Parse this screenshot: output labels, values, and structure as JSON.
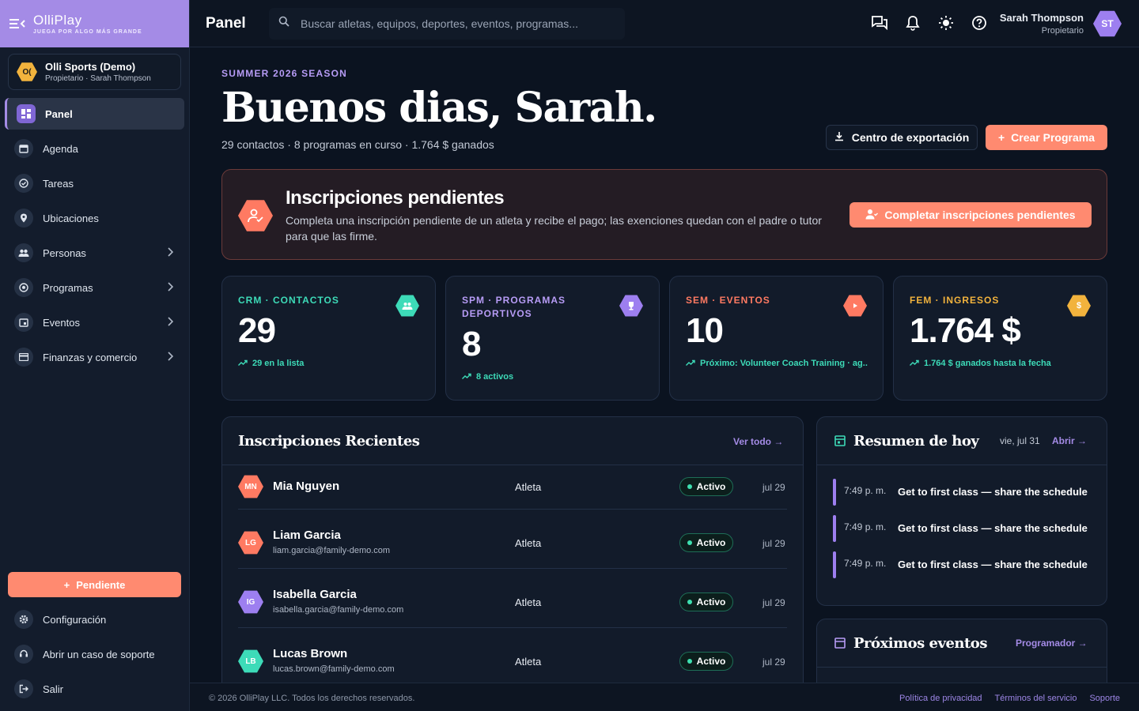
{
  "brand": {
    "name": "OlliPlay",
    "tagline": "JUEGA POR ALGO MÁS GRANDE",
    "color": "#a48be6"
  },
  "org": {
    "name": "Olli Sports (Demo)",
    "sub": "Propietario · Sarah Thompson",
    "badge": "O("
  },
  "sidebar": {
    "items": [
      {
        "label": "Panel",
        "icon": "dashboard-icon",
        "active": true
      },
      {
        "label": "Agenda",
        "icon": "calendar-icon"
      },
      {
        "label": "Tareas",
        "icon": "check-circle-icon"
      },
      {
        "label": "Ubicaciones",
        "icon": "location-pin-icon"
      },
      {
        "label": "Personas",
        "icon": "people-icon",
        "expandable": true
      },
      {
        "label": "Programas",
        "icon": "soccer-ball-icon",
        "expandable": true
      },
      {
        "label": "Eventos",
        "icon": "event-icon",
        "expandable": true
      },
      {
        "label": "Finanzas y comercio",
        "icon": "credit-card-icon",
        "expandable": true
      }
    ],
    "pending_label": "Pendiente",
    "bottom": [
      {
        "label": "Configuración",
        "icon": "gear-icon"
      },
      {
        "label": "Abrir un caso de soporte",
        "icon": "support-agent-icon"
      },
      {
        "label": "Salir",
        "icon": "logout-icon"
      }
    ]
  },
  "topbar": {
    "title": "Panel",
    "search_placeholder": "Buscar atletas, equipos, deportes, eventos, programas...",
    "user_name": "Sarah Thompson",
    "user_role": "Propietario",
    "user_initials": "ST"
  },
  "hero": {
    "season": "SUMMER 2026 SEASON",
    "greeting": "Buenos dias, Sarah.",
    "subtitle": "29 contactos · 8 programas en curso · 1.764 $ ganados",
    "export_label": "Centro de exportación",
    "create_label": "Crear Programa"
  },
  "alert": {
    "title": "Inscripciones pendientes",
    "text": "Completa una inscripción pendiente de un atleta y recibe el pago; las exenciones quedan con el padre o tutor para que las firme.",
    "button": "Completar inscripciones pendientes"
  },
  "stats": [
    {
      "label": "CRM · CONTACTOS",
      "value": "29",
      "note": "29 en la lista",
      "color": "#3ddbb8",
      "icon": "group-icon"
    },
    {
      "label": "SPM · PROGRAMAS DEPORTIVOS",
      "value": "8",
      "note": "8 activos",
      "color": "#b79cf6",
      "icon": "trophy-icon"
    },
    {
      "label": "SEM · EVENTOS",
      "value": "10",
      "note": "Próximo: Volunteer Coach Training · ag...",
      "color": "#ff7a62",
      "icon": "play-icon"
    },
    {
      "label": "FEM · INGRESOS",
      "value": "1.764 $",
      "note": "1.764 $ ganados hasta la fecha",
      "color": "#f2b33d",
      "icon": "dollar-icon"
    }
  ],
  "recent": {
    "title": "Inscripciones Recientes",
    "link": "Ver todo →",
    "rows": [
      {
        "initials": "MN",
        "name": "Mia Nguyen",
        "email": "",
        "role": "Atleta",
        "status": "Activo",
        "date": "jul 29",
        "color": "#ff7a62"
      },
      {
        "initials": "LG",
        "name": "Liam Garcia",
        "email": "liam.garcia@family-demo.com",
        "role": "Atleta",
        "status": "Activo",
        "date": "jul 29",
        "color": "#ff7a62"
      },
      {
        "initials": "IG",
        "name": "Isabella Garcia",
        "email": "isabella.garcia@family-demo.com",
        "role": "Atleta",
        "status": "Activo",
        "date": "jul 29",
        "color": "#9d7ff0"
      },
      {
        "initials": "LB",
        "name": "Lucas Brown",
        "email": "lucas.brown@family-demo.com",
        "role": "Atleta",
        "status": "Activo",
        "date": "jul 29",
        "color": "#3ddbb8"
      }
    ]
  },
  "today": {
    "title": "Resumen de hoy",
    "date": "vie, jul 31",
    "link": "Abrir →",
    "items": [
      {
        "time": "7:49 p. m.",
        "text": "Get to first class — share the schedule"
      },
      {
        "time": "7:49 p. m.",
        "text": "Get to first class — share the schedule"
      },
      {
        "time": "7:49 p. m.",
        "text": "Get to first class — share the schedule"
      }
    ]
  },
  "upcoming": {
    "title": "Próximos eventos",
    "link": "Programador →"
  },
  "footer": {
    "copyright": "© 2026 OlliPlay LLC. Todos los derechos reservados.",
    "links": [
      "Política de privacidad",
      "Términos del servicio",
      "Soporte"
    ]
  }
}
